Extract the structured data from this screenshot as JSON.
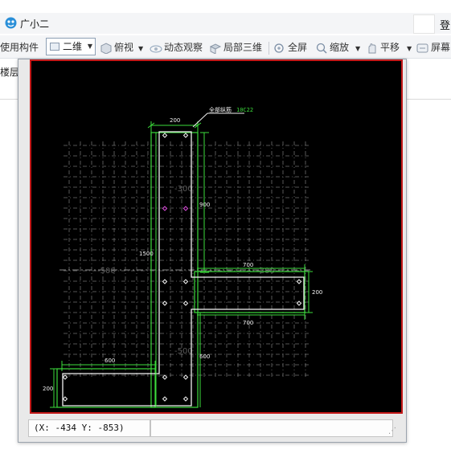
{
  "app": {
    "title": "广小二",
    "login_label": "登"
  },
  "toolbar": {
    "use_component": "使用构件",
    "view_mode": "二维",
    "top_view": "俯视",
    "orbit": "动态观察",
    "local_3d": "局部三维",
    "fullscreen": "全屏",
    "zoom": "缩放",
    "pan": "平移",
    "screen": "屏幕"
  },
  "floorbar": {
    "label": "楼层"
  },
  "drawing": {
    "callout_label": "全部纵筋",
    "callout_value": "10C22",
    "dims": {
      "top_width": "200",
      "v_1500": "1500",
      "v_900": "900",
      "h_700_top": "700",
      "h_700_bottom": "700",
      "right_200": "200",
      "bottom_600": "600",
      "right_600": "600",
      "left_200": "200"
    },
    "grid_labels": {
      "n300": "-300",
      "n500a": "-500",
      "n500b": "-500",
      "n200": "-200"
    }
  },
  "status": {
    "coords": "(X: -434 Y: -853)"
  }
}
